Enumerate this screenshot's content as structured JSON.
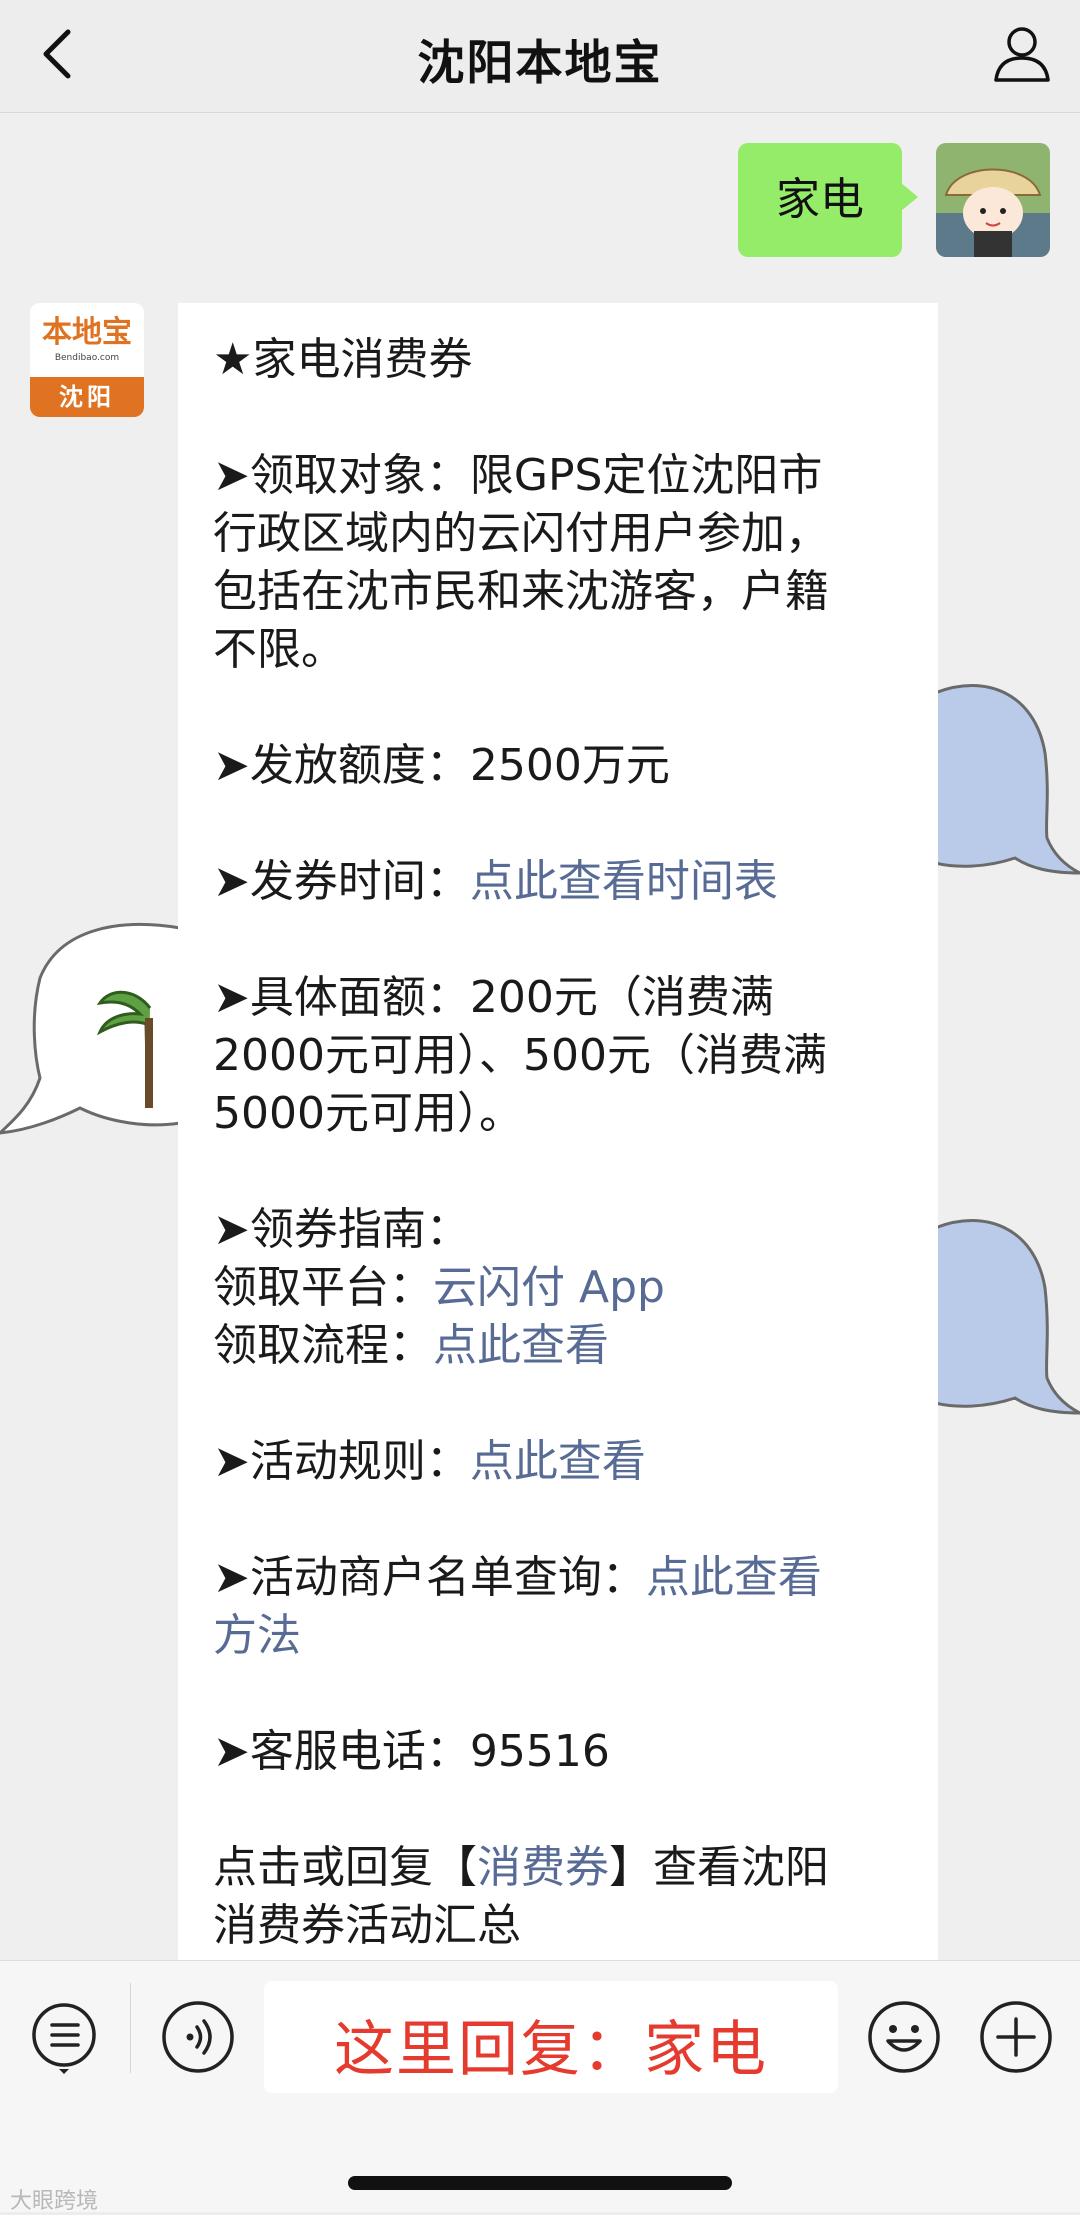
{
  "nav": {
    "title": "沈阳本地宝"
  },
  "user_message": {
    "text": "家电"
  },
  "bot": {
    "avatar_logo_cn": "本地宝",
    "avatar_logo_en": "Bendibao.com",
    "avatar_city": "沈阳"
  },
  "card": {
    "heading": "★家电消费券",
    "target": {
      "line1": "➤领取对象：限GPS定位沈阳市",
      "line2": "行政区域内的云闪付用户参加，",
      "line3": "包括在沈市民和来沈游客，户籍",
      "line4": "不限。"
    },
    "quota": "➤发放额度：2500万元",
    "time": {
      "label": "➤发券时间：",
      "link": "点此查看时间表"
    },
    "amount": {
      "line1": "➤具体面额：200元（消费满",
      "line2": "2000元可用）、500元（消费满",
      "line3": "5000元可用）。"
    },
    "guide": {
      "label": "➤领券指南：",
      "platform_label": "领取平台：",
      "platform_link": "云闪付 App",
      "process_label": "领取流程：",
      "process_link": "点此查看"
    },
    "rules": {
      "label": "➤活动规则：",
      "link": "点此查看"
    },
    "merchants": {
      "label": "➤活动商户名单查询：",
      "link1": "点此查看",
      "link2": "方法"
    },
    "phone": "➤客服电话：95516",
    "footer": {
      "prefix": "点击或回复【",
      "link": "消费券",
      "suffix": "】查看沈阳",
      "line2": "消费券活动汇总"
    }
  },
  "input_bar": {
    "reply_hint": "这里回复：家电",
    "watermark": "大眼跨境"
  },
  "colors": {
    "link": "#576b95",
    "user_bubble": "#95ec69",
    "reply_hint": "#e53b2f",
    "brand_orange": "#e07322"
  }
}
